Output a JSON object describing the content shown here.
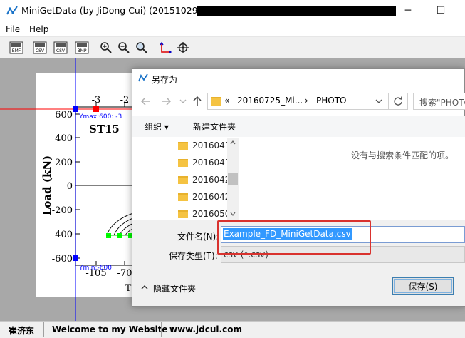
{
  "window": {
    "title": "MiniGetData (by JiDong Cui) (20151029) -",
    "minimize_glyph": "─",
    "maximize_glyph": "☐"
  },
  "menu": {
    "items": [
      "File",
      "Help"
    ]
  },
  "toolbar": {
    "buttons": [
      {
        "name": "open-emf",
        "label": "EMF"
      },
      {
        "name": "save-csv",
        "label": "CSV"
      },
      {
        "name": "data-csv",
        "label": "CSV"
      },
      {
        "name": "save-bmp",
        "label": "BMP"
      }
    ],
    "zoom_icons": [
      "zoom-in-icon",
      "zoom-out-icon",
      "zoom-fit-icon"
    ],
    "axis_icon": "axis-icon",
    "crosshair_icon": "crosshair-icon"
  },
  "plot": {
    "ylabel": "Load (kN)",
    "specimen": "ST15",
    "yticks": [
      "600",
      "400",
      "200",
      "0",
      "-200",
      "-400",
      "-600"
    ],
    "xticks_top": [
      "-3",
      "-2"
    ],
    "xticks_bottom": [
      "-105",
      "-70"
    ],
    "bottom_letter": "T",
    "ymax_label": "Ymax:600: -3",
    "ymin_label": "Ymin:-600",
    "colors": {
      "marker_blue": "#0000ff",
      "marker_red": "#ff0000",
      "marker_green": "#00ff00"
    }
  },
  "status": {
    "author": "崔济东",
    "welcome": "Welcome to my Website :",
    "website": "www.jdcui.com"
  },
  "dialog": {
    "title": "另存为",
    "breadcrumb": [
      "«",
      "20160725_Mi...",
      "›",
      "PHOTO"
    ],
    "search_placeholder": "搜索\"PHOTO\"",
    "organize": "组织 ▾",
    "new_folder": "新建文件夹",
    "folders": [
      "2016041",
      "2016041",
      "2016042",
      "2016042",
      "2016050"
    ],
    "empty_message": "没有与搜索条件匹配的项。",
    "filename_label": "文件名(N):",
    "filename_value": "Example_FD_MiniGetData.csv",
    "filetype_label": "保存类型(T):",
    "filetype_value": "csv (*.csv)",
    "hide_folders": "隐藏文件夹",
    "save_button": "保存(S)",
    "accent": "#3399ff",
    "highlight_color": "#d9322e"
  }
}
